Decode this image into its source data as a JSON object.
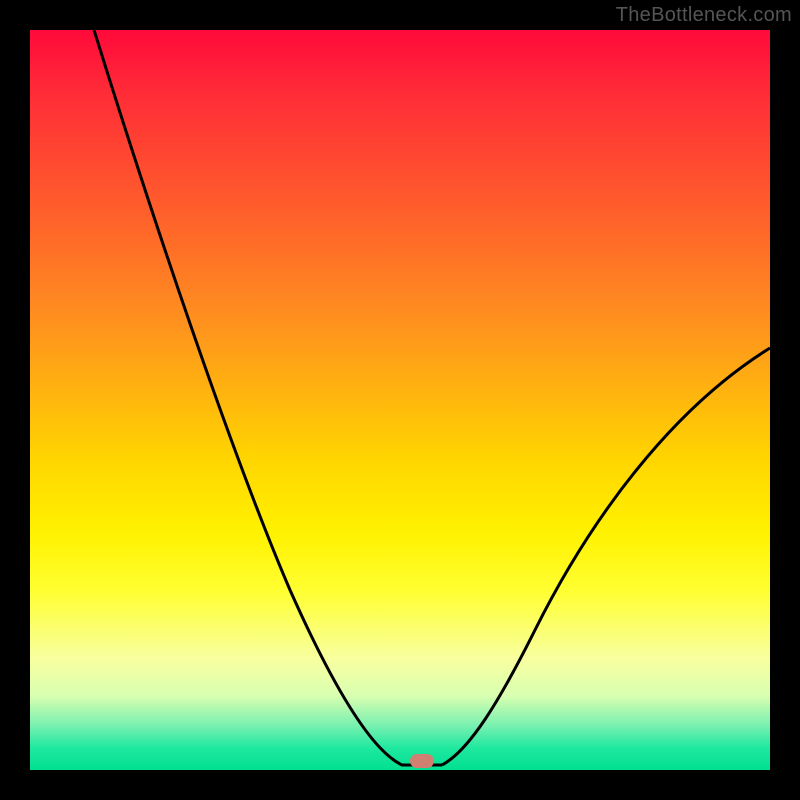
{
  "watermark": "TheBottleneck.com",
  "colors": {
    "background": "#000000",
    "curve": "#000000",
    "marker": "#d08070"
  },
  "chart_data": {
    "type": "line",
    "title": "",
    "xlabel": "",
    "ylabel": "",
    "ylim": [
      0,
      100
    ],
    "xlim": [
      0,
      100
    ],
    "x": [
      0,
      5,
      10,
      15,
      20,
      25,
      30,
      35,
      40,
      45,
      50,
      52,
      54,
      56,
      60,
      65,
      70,
      75,
      80,
      85,
      90,
      95,
      100
    ],
    "values": [
      100,
      90,
      80,
      70,
      60,
      50,
      41,
      32,
      23,
      14,
      5,
      1,
      0,
      1,
      6,
      14,
      22,
      29,
      36,
      42,
      48,
      53,
      57
    ],
    "marker": {
      "x": 54,
      "y": 0
    }
  }
}
